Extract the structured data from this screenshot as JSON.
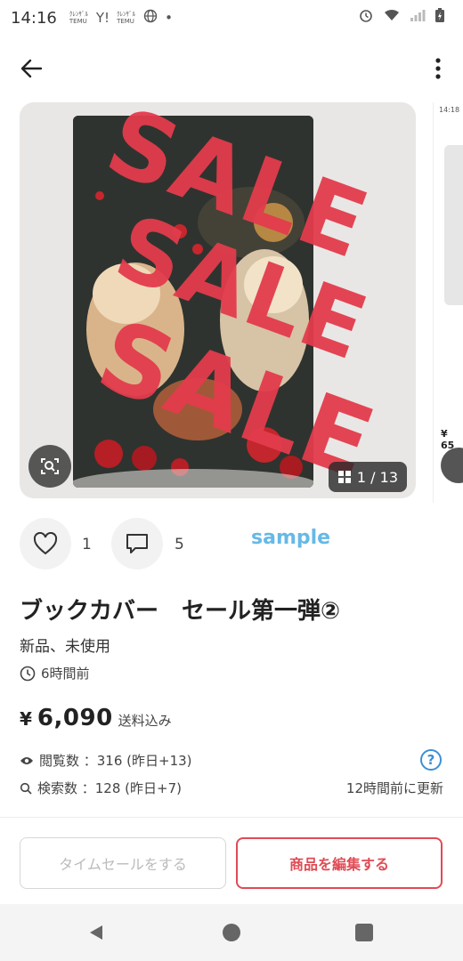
{
  "status_bar": {
    "time": "14:16",
    "temu_label": "ｸﾚﾝｻﾞﾙ\nTEMU",
    "yahoo_label": "Y!",
    "dot": "•"
  },
  "topbar": {
    "back_icon": "arrow-left",
    "more_icon": "kebab-vertical"
  },
  "gallery": {
    "sale_words": [
      "SALE",
      "SALE",
      "SALE"
    ],
    "counter_text": "1 / 13",
    "accent_sale": "#e33c4c",
    "next_thumb_time": "14:18",
    "next_thumb_price": "¥ 65"
  },
  "social": {
    "like_count": "1",
    "comment_count": "5",
    "watermark": "sample"
  },
  "item": {
    "title": "ブックカバー　セール第一弾②",
    "condition": "新品、未使用",
    "posted": "6時間前",
    "yen": "¥",
    "price": "6,090",
    "shipping": "送料込み"
  },
  "stats": {
    "views": "閲覧数 ：316 (昨日+13)",
    "searches": "検索数 ：128 (昨日+7)",
    "help": "?",
    "updated": "12時間前に更新"
  },
  "actions": {
    "time_sale": "タイムセールをする",
    "edit": "商品を編集する",
    "edit_color": "#e04b55"
  }
}
